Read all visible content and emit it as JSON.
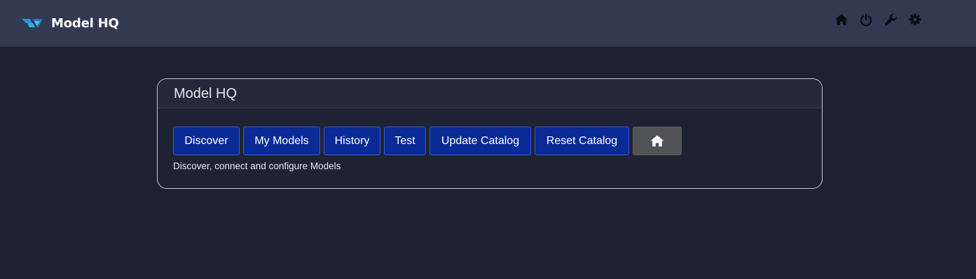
{
  "app": {
    "title": "Model HQ",
    "logo_icon": "model-hq-logo-icon"
  },
  "header_icons": [
    {
      "name": "home-icon"
    },
    {
      "name": "power-icon"
    },
    {
      "name": "wrench-icon"
    },
    {
      "name": "gear-icon"
    }
  ],
  "card": {
    "title": "Model HQ",
    "buttons": [
      {
        "label": "Discover"
      },
      {
        "label": "My Models"
      },
      {
        "label": "History"
      },
      {
        "label": "Test"
      },
      {
        "label": "Update Catalog"
      },
      {
        "label": "Reset Catalog"
      }
    ],
    "home_button_icon": "home-icon",
    "caption": "Discover, connect and configure Models"
  },
  "colors": {
    "topbar": "#323a52",
    "background": "#1e2130",
    "primary_button": "#0a2a96",
    "home_button": "#505256"
  }
}
